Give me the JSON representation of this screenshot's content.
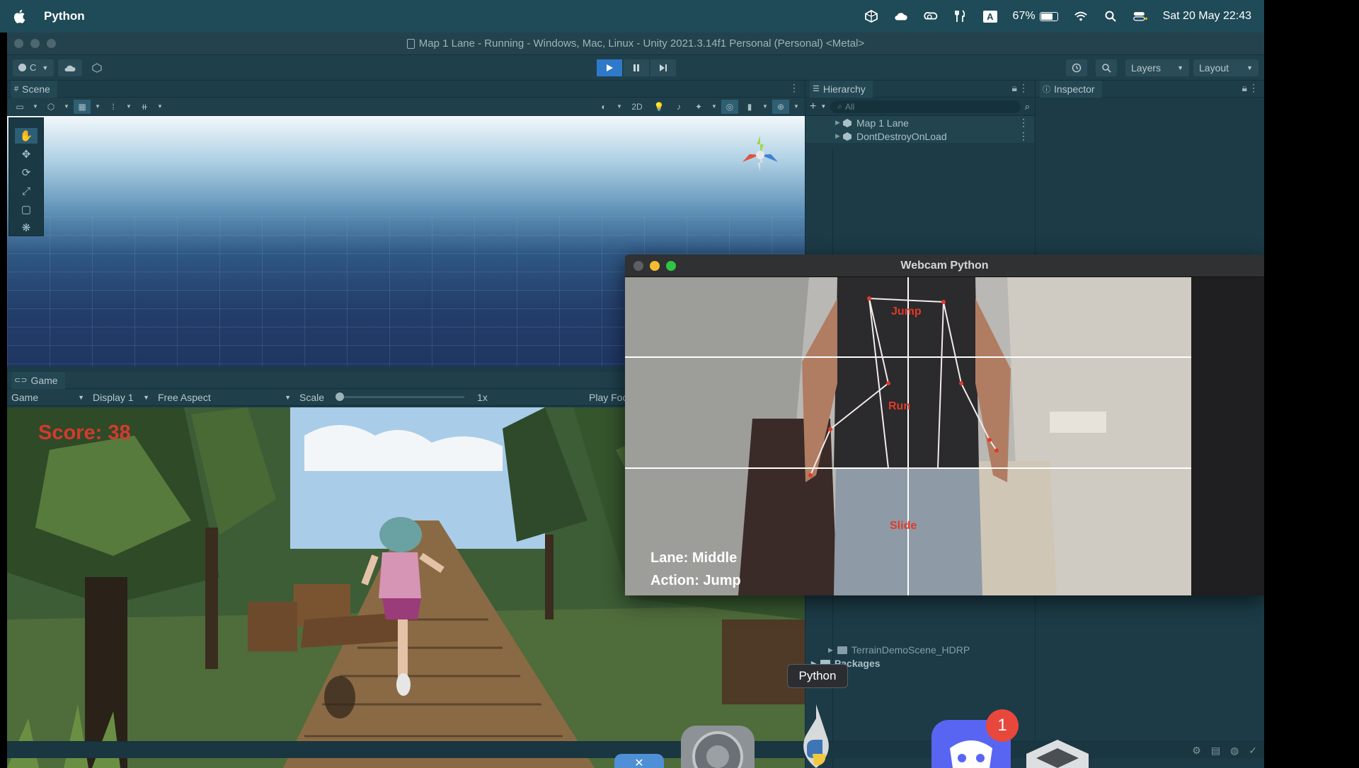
{
  "menubar": {
    "app_name": "Python",
    "battery": "67%",
    "battery_level": 0.67,
    "keyboard_indicator": "A",
    "datetime": "Sat 20 May  22:43"
  },
  "unity": {
    "window_title": "Map 1 Lane - Running - Windows, Mac, Linux - Unity 2021.3.14f1 Personal (Personal) <Metal>",
    "account_label": "C",
    "layers_label": "Layers",
    "layout_label": "Layout",
    "scene_tab": "Scene",
    "scene_2d_label": "2D",
    "game_tab": "Game",
    "game_mode": "Game",
    "display": "Display 1",
    "aspect": "Free Aspect",
    "scale_label": "Scale",
    "scale_value": "1x",
    "play_focus_label": "Play Foc",
    "score_text": "Score: 38",
    "hierarchy_tab": "Hierarchy",
    "hierarchy_search_placeholder": "All",
    "hierarchy_items": [
      "Map 1 Lane",
      "DontDestroyOnLoad"
    ],
    "inspector_tab": "Inspector",
    "project_items": [
      "TerrainDemoScene_HDRP",
      "Packages"
    ]
  },
  "webcam": {
    "title": "Webcam Python",
    "zone_labels": {
      "top": "Jump",
      "middle": "Run",
      "bottom": "Slide"
    },
    "lane_text": "Lane:  Middle",
    "action_text": "Action:  Jump"
  },
  "dock": {
    "tooltip": "Python",
    "discord_badge": "1"
  },
  "colors": {
    "menubar_bg": "#1f4a57",
    "unity_bg": "#1c3b47",
    "play_active": "#2f79c9",
    "score_red": "#d33a2e",
    "pose_label_red": "#e03a2a"
  }
}
